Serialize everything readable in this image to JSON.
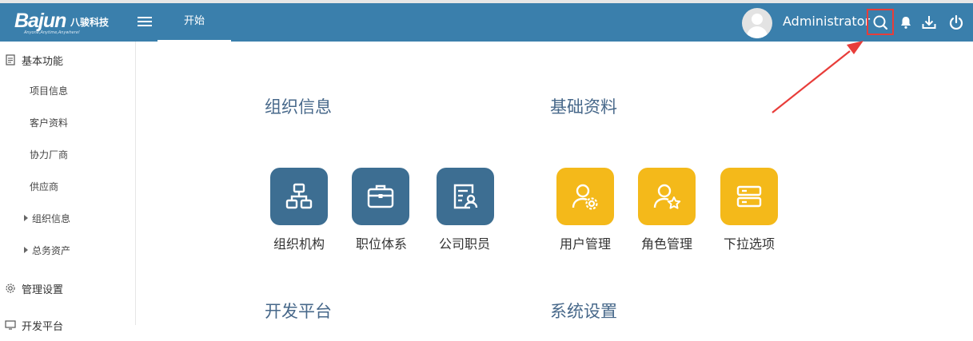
{
  "header": {
    "brand_name": "Bajun",
    "brand_cn": "八骏科技",
    "brand_tagline": "Anyone,Anytime,Anywhere!",
    "tab_label": "开始",
    "username": "Administrator",
    "icons": [
      "menu-icon",
      "search-icon",
      "bell-icon",
      "download-icon",
      "power-icon"
    ],
    "highlight_color": "#e83d3a",
    "bar_color": "#3a7fac"
  },
  "sidebar": {
    "groups": [
      {
        "label": "基本功能",
        "icon": "document-icon"
      },
      {
        "label": "管理设置",
        "icon": "gear-icon"
      },
      {
        "label": "开发平台",
        "icon": "monitor-icon"
      }
    ],
    "items": [
      "项目信息",
      "客户资料",
      "协力厂商",
      "供应商"
    ],
    "subgroups": [
      "组织信息",
      "总务资产"
    ]
  },
  "main": {
    "sections": [
      {
        "title": "组织信息",
        "color": "#3d6e92",
        "tiles": [
          {
            "label": "组织机构",
            "icon": "org-chart-icon"
          },
          {
            "label": "职位体系",
            "icon": "briefcase-icon"
          },
          {
            "label": "公司职员",
            "icon": "id-card-icon"
          }
        ]
      },
      {
        "title": "基础资料",
        "color": "#f4b91a",
        "tiles": [
          {
            "label": "用户管理",
            "icon": "user-gear-icon"
          },
          {
            "label": "角色管理",
            "icon": "user-star-icon"
          },
          {
            "label": "下拉选项",
            "icon": "list-box-icon"
          }
        ]
      },
      {
        "title": "开发平台"
      },
      {
        "title": "系统设置"
      }
    ]
  }
}
